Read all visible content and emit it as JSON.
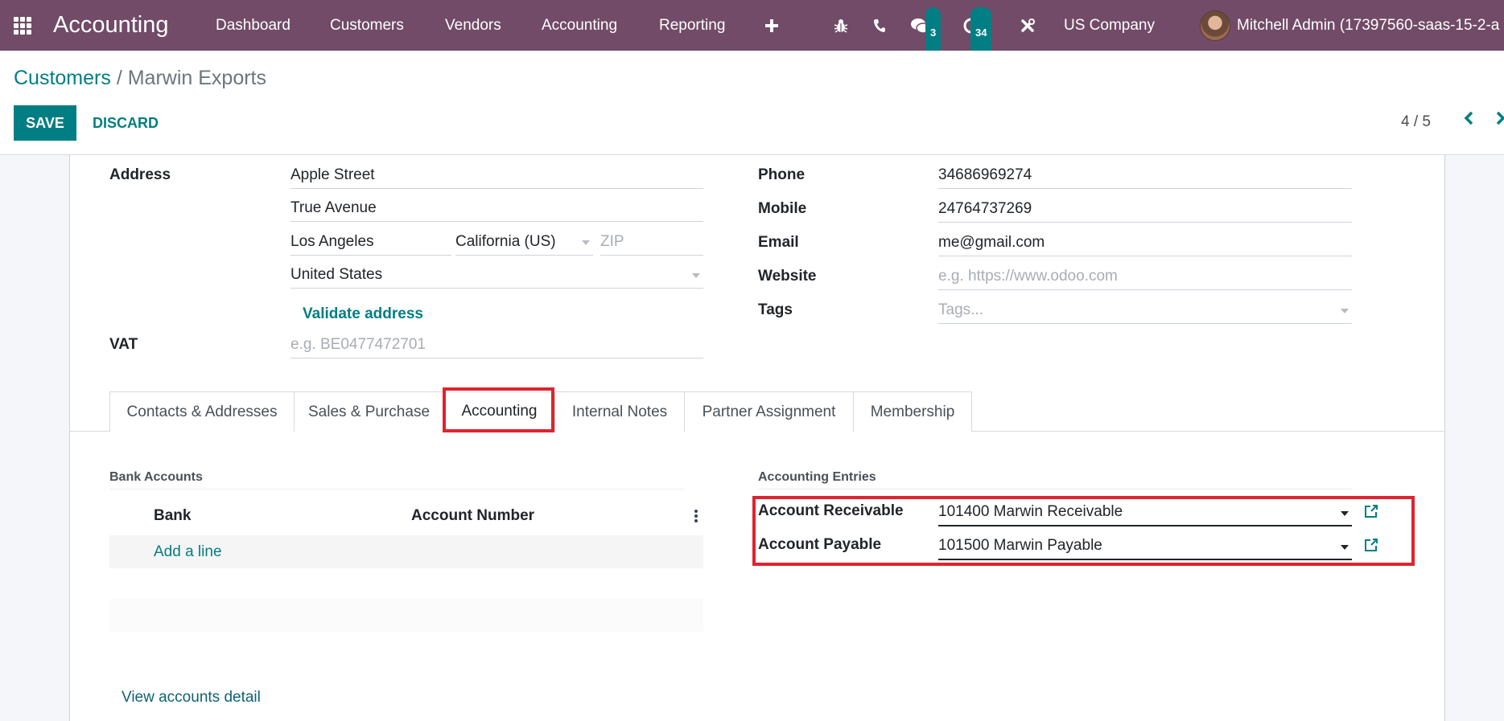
{
  "navbar": {
    "app_name": "Accounting",
    "menu": [
      "Dashboard",
      "Customers",
      "Vendors",
      "Accounting",
      "Reporting"
    ],
    "icons": {
      "apps": "apps-grid-icon",
      "new": "plus-icon",
      "debug": "bug-icon",
      "phone": "phone-icon",
      "messages": "chat-icon",
      "activities": "clock-icon",
      "tools": "tools-icon"
    },
    "messages_count": "3",
    "activities_count": "34",
    "company": "US Company",
    "user": "Mitchell Admin (17397560-saas-15-2-a"
  },
  "control_panel": {
    "breadcrumb_parent": "Customers",
    "breadcrumb_sep": "/",
    "breadcrumb_current": "Marwin Exports",
    "save_label": "SAVE",
    "discard_label": "DISCARD",
    "pager_value": "4 / 5",
    "pager_prev": "‹",
    "pager_next": "›"
  },
  "form": {
    "address": {
      "label": "Address",
      "street": "Apple Street",
      "street2": "True Avenue",
      "city": "Los Angeles",
      "state": "California (US)",
      "zip_placeholder": "ZIP",
      "country": "United States",
      "validate_link": "Validate address"
    },
    "vat": {
      "label": "VAT",
      "placeholder": "e.g. BE0477472701"
    },
    "phone": {
      "label": "Phone",
      "value": "34686969274"
    },
    "mobile": {
      "label": "Mobile",
      "value": "24764737269"
    },
    "email": {
      "label": "Email",
      "value": "me@gmail.com"
    },
    "website": {
      "label": "Website",
      "placeholder": "e.g. https://www.odoo.com"
    },
    "tags": {
      "label": "Tags",
      "placeholder": "Tags..."
    }
  },
  "tabs": [
    {
      "label": "Contacts & Addresses",
      "active": false
    },
    {
      "label": "Sales & Purchase",
      "active": false
    },
    {
      "label": "Accounting",
      "active": true
    },
    {
      "label": "Internal Notes",
      "active": false
    },
    {
      "label": "Partner Assignment",
      "active": false
    },
    {
      "label": "Membership",
      "active": false
    }
  ],
  "accounting_tab": {
    "bank_accounts": {
      "title": "Bank Accounts",
      "columns": [
        "Bank",
        "Account Number"
      ],
      "add_line": "Add a line",
      "rows": []
    },
    "accounting_entries": {
      "title": "Accounting Entries",
      "receivable_label": "Account Receivable",
      "receivable_value": "101400 Marwin Receivable",
      "payable_label": "Account Payable",
      "payable_value": "101500 Marwin Payable"
    },
    "view_accounts_link": "View accounts detail"
  },
  "colors": {
    "navbar": "#714B67",
    "primary": "#017e84",
    "highlight": "#e0232e"
  }
}
